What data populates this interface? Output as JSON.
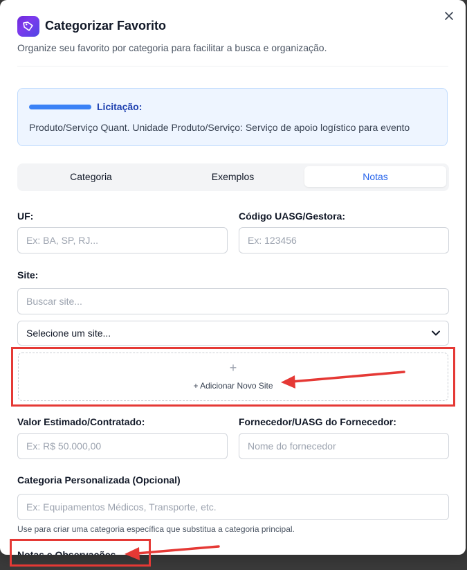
{
  "dialog": {
    "title": "Categorizar Favorito",
    "subtitle": "Organize seu favorito por categoria para facilitar a busca e organização.",
    "close_label": "×"
  },
  "info": {
    "label": "Licitação:",
    "text": "Produto/Serviço Quant. Unidade Produto/Serviço: Serviço de apoio logístico para evento"
  },
  "tabs": [
    {
      "label": "Categoria",
      "active": false
    },
    {
      "label": "Exemplos",
      "active": false
    },
    {
      "label": "Notas",
      "active": true
    }
  ],
  "form": {
    "uf": {
      "label": "UF:",
      "placeholder": "Ex: BA, SP, RJ..."
    },
    "uasg": {
      "label": "Código UASG/Gestora:",
      "placeholder": "Ex: 123456"
    },
    "site": {
      "label": "Site:",
      "search_placeholder": "Buscar site...",
      "select_value": "Selecione um site...",
      "add_plus": "+",
      "add_label": "+ Adicionar Novo Site"
    },
    "valor": {
      "label": "Valor Estimado/Contratado:",
      "placeholder": "Ex: R$ 50.000,00"
    },
    "fornecedor": {
      "label": "Fornecedor/UASG do Fornecedor:",
      "placeholder": "Nome do fornecedor"
    },
    "categoria": {
      "label": "Categoria Personalizada (Opcional)",
      "placeholder": "Ex: Equipamentos Médicos, Transporte, etc.",
      "helper": "Use para criar uma categoria específica que substitua a categoria principal."
    },
    "notas": {
      "heading": "Notas e Observações"
    }
  },
  "colors": {
    "accent": "#2563eb",
    "icon_gradient_start": "#7c3aed",
    "annotation_red": "#e53935",
    "info_bg": "#eef5ff"
  },
  "icons": {
    "app": "tag-icon",
    "close": "close-icon",
    "select": "chevron-down-icon"
  }
}
